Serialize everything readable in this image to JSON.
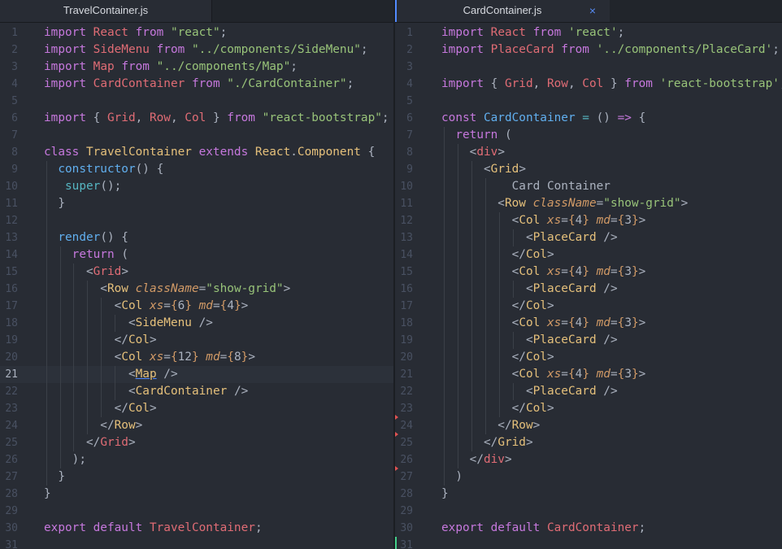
{
  "left_pane": {
    "tab": {
      "title": "TravelContainer.js"
    },
    "cursor_line": 21,
    "lines": [
      [
        [
          "k",
          "import "
        ],
        [
          "v",
          "React "
        ],
        [
          "k",
          "from "
        ],
        [
          "s",
          "\"react\""
        ],
        [
          "p",
          ";"
        ]
      ],
      [
        [
          "k",
          "import "
        ],
        [
          "v",
          "SideMenu "
        ],
        [
          "k",
          "from "
        ],
        [
          "s",
          "\"../components/SideMenu\""
        ],
        [
          "p",
          ";"
        ]
      ],
      [
        [
          "k",
          "import "
        ],
        [
          "v",
          "Map "
        ],
        [
          "k",
          "from "
        ],
        [
          "s",
          "\"../components/Map\""
        ],
        [
          "p",
          ";"
        ]
      ],
      [
        [
          "k",
          "import "
        ],
        [
          "v",
          "CardContainer "
        ],
        [
          "k",
          "from "
        ],
        [
          "s",
          "\"./CardContainer\""
        ],
        [
          "p",
          ";"
        ]
      ],
      [],
      [
        [
          "k",
          "import "
        ],
        [
          "p",
          "{ "
        ],
        [
          "v",
          "Grid"
        ],
        [
          "p",
          ", "
        ],
        [
          "v",
          "Row"
        ],
        [
          "p",
          ", "
        ],
        [
          "v",
          "Col "
        ],
        [
          "p",
          "} "
        ],
        [
          "k",
          "from "
        ],
        [
          "s",
          "\"react-bootstrap\""
        ],
        [
          "p",
          ";"
        ]
      ],
      [],
      [
        [
          "k",
          "class "
        ],
        [
          "c",
          "TravelContainer "
        ],
        [
          "k",
          "extends "
        ],
        [
          "c",
          "React"
        ],
        [
          "p",
          "."
        ],
        [
          "c",
          "Component "
        ],
        [
          "p",
          "{"
        ]
      ],
      [
        [
          "p",
          "  "
        ],
        [
          "f",
          "constructor"
        ],
        [
          "p",
          "() {"
        ]
      ],
      [
        [
          "p",
          "   "
        ],
        [
          "o",
          "super"
        ],
        [
          "p",
          "();"
        ]
      ],
      [
        [
          "p",
          "  }"
        ]
      ],
      [],
      [
        [
          "p",
          "  "
        ],
        [
          "f",
          "render"
        ],
        [
          "p",
          "() {"
        ]
      ],
      [
        [
          "p",
          "    "
        ],
        [
          "k",
          "return "
        ],
        [
          "p",
          "("
        ]
      ],
      [
        [
          "p",
          "      <"
        ],
        [
          "t",
          "Grid"
        ],
        [
          "p",
          ">"
        ]
      ],
      [
        [
          "p",
          "        <"
        ],
        [
          "c",
          "Row "
        ],
        [
          "a",
          "className"
        ],
        [
          "p",
          "="
        ],
        [
          "s",
          "\"show-grid\""
        ],
        [
          "p",
          ">"
        ]
      ],
      [
        [
          "p",
          "          <"
        ],
        [
          "c",
          "Col "
        ],
        [
          "a",
          "xs"
        ],
        [
          "p",
          "="
        ],
        [
          "n",
          "{"
        ],
        [
          "p",
          "6"
        ],
        [
          "n",
          "} "
        ],
        [
          "a",
          "md"
        ],
        [
          "p",
          "="
        ],
        [
          "n",
          "{"
        ],
        [
          "p",
          "4"
        ],
        [
          "n",
          "}"
        ],
        [
          "p",
          ">"
        ]
      ],
      [
        [
          "p",
          "            <"
        ],
        [
          "c",
          "SideMenu "
        ],
        [
          "p",
          "/>"
        ]
      ],
      [
        [
          "p",
          "          </"
        ],
        [
          "c",
          "Col"
        ],
        [
          "p",
          ">"
        ]
      ],
      [
        [
          "p",
          "          <"
        ],
        [
          "c",
          "Col "
        ],
        [
          "a",
          "xs"
        ],
        [
          "p",
          "="
        ],
        [
          "n",
          "{"
        ],
        [
          "p",
          "12"
        ],
        [
          "n",
          "} "
        ],
        [
          "a",
          "md"
        ],
        [
          "p",
          "="
        ],
        [
          "n",
          "{"
        ],
        [
          "p",
          "8"
        ],
        [
          "n",
          "}"
        ],
        [
          "p",
          ">"
        ]
      ],
      [
        [
          "p",
          "            <"
        ],
        [
          "c ul",
          "Map"
        ],
        [
          "p",
          " />"
        ]
      ],
      [
        [
          "p",
          "            <"
        ],
        [
          "c",
          "CardContainer "
        ],
        [
          "p",
          "/>"
        ]
      ],
      [
        [
          "p",
          "          </"
        ],
        [
          "c",
          "Col"
        ],
        [
          "p",
          ">"
        ]
      ],
      [
        [
          "p",
          "        </"
        ],
        [
          "c",
          "Row"
        ],
        [
          "p",
          ">"
        ]
      ],
      [
        [
          "p",
          "      </"
        ],
        [
          "t",
          "Grid"
        ],
        [
          "p",
          ">"
        ]
      ],
      [
        [
          "p",
          "    );"
        ]
      ],
      [
        [
          "p",
          "  }"
        ]
      ],
      [
        [
          "p",
          "}"
        ]
      ],
      [],
      [
        [
          "k",
          "export default "
        ],
        [
          "v",
          "TravelContainer"
        ],
        [
          "p",
          ";"
        ]
      ],
      []
    ]
  },
  "right_pane": {
    "tab": {
      "title": "CardContainer.js",
      "close_icon": "×"
    },
    "git_deleted_after_lines": [
      23,
      24,
      26
    ],
    "git_added_lines": [
      31
    ],
    "lines": [
      [
        [
          "k",
          "import "
        ],
        [
          "v",
          "React "
        ],
        [
          "k",
          "from "
        ],
        [
          "s",
          "'react'"
        ],
        [
          "p",
          ";"
        ]
      ],
      [
        [
          "k",
          "import "
        ],
        [
          "v",
          "PlaceCard "
        ],
        [
          "k",
          "from "
        ],
        [
          "s",
          "'../components/PlaceCard'"
        ],
        [
          "p",
          ";"
        ]
      ],
      [],
      [
        [
          "k",
          "import "
        ],
        [
          "p",
          "{ "
        ],
        [
          "v",
          "Grid"
        ],
        [
          "p",
          ", "
        ],
        [
          "v",
          "Row"
        ],
        [
          "p",
          ", "
        ],
        [
          "v",
          "Col "
        ],
        [
          "p",
          "} "
        ],
        [
          "k",
          "from "
        ],
        [
          "s",
          "'react-bootstrap'"
        ],
        [
          "p",
          ";"
        ]
      ],
      [],
      [
        [
          "k",
          "const "
        ],
        [
          "f",
          "CardContainer "
        ],
        [
          "o",
          "= "
        ],
        [
          "p",
          "() "
        ],
        [
          "k",
          "=> "
        ],
        [
          "p",
          "{"
        ]
      ],
      [
        [
          "p",
          "  "
        ],
        [
          "k",
          "return "
        ],
        [
          "p",
          "("
        ]
      ],
      [
        [
          "p",
          "    <"
        ],
        [
          "t",
          "div"
        ],
        [
          "p",
          ">"
        ]
      ],
      [
        [
          "p",
          "      <"
        ],
        [
          "c",
          "Grid"
        ],
        [
          "p",
          ">"
        ]
      ],
      [
        [
          "p",
          "          Card Container"
        ]
      ],
      [
        [
          "p",
          "        <"
        ],
        [
          "c",
          "Row "
        ],
        [
          "a",
          "className"
        ],
        [
          "p",
          "="
        ],
        [
          "s",
          "\"show-grid\""
        ],
        [
          "p",
          ">"
        ]
      ],
      [
        [
          "p",
          "          <"
        ],
        [
          "c",
          "Col "
        ],
        [
          "a",
          "xs"
        ],
        [
          "p",
          "="
        ],
        [
          "n",
          "{"
        ],
        [
          "p",
          "4"
        ],
        [
          "n",
          "} "
        ],
        [
          "a",
          "md"
        ],
        [
          "p",
          "="
        ],
        [
          "n",
          "{"
        ],
        [
          "p",
          "3"
        ],
        [
          "n",
          "}"
        ],
        [
          "p",
          ">"
        ]
      ],
      [
        [
          "p",
          "            <"
        ],
        [
          "c",
          "PlaceCard "
        ],
        [
          "p",
          "/>"
        ]
      ],
      [
        [
          "p",
          "          </"
        ],
        [
          "c",
          "Col"
        ],
        [
          "p",
          ">"
        ]
      ],
      [
        [
          "p",
          "          <"
        ],
        [
          "c",
          "Col "
        ],
        [
          "a",
          "xs"
        ],
        [
          "p",
          "="
        ],
        [
          "n",
          "{"
        ],
        [
          "p",
          "4"
        ],
        [
          "n",
          "} "
        ],
        [
          "a",
          "md"
        ],
        [
          "p",
          "="
        ],
        [
          "n",
          "{"
        ],
        [
          "p",
          "3"
        ],
        [
          "n",
          "}"
        ],
        [
          "p",
          ">"
        ]
      ],
      [
        [
          "p",
          "            <"
        ],
        [
          "c",
          "PlaceCard "
        ],
        [
          "p",
          "/>"
        ]
      ],
      [
        [
          "p",
          "          </"
        ],
        [
          "c",
          "Col"
        ],
        [
          "p",
          ">"
        ]
      ],
      [
        [
          "p",
          "          <"
        ],
        [
          "c",
          "Col "
        ],
        [
          "a",
          "xs"
        ],
        [
          "p",
          "="
        ],
        [
          "n",
          "{"
        ],
        [
          "p",
          "4"
        ],
        [
          "n",
          "} "
        ],
        [
          "a",
          "md"
        ],
        [
          "p",
          "="
        ],
        [
          "n",
          "{"
        ],
        [
          "p",
          "3"
        ],
        [
          "n",
          "}"
        ],
        [
          "p",
          ">"
        ]
      ],
      [
        [
          "p",
          "            <"
        ],
        [
          "c",
          "PlaceCard "
        ],
        [
          "p",
          "/>"
        ]
      ],
      [
        [
          "p",
          "          </"
        ],
        [
          "c",
          "Col"
        ],
        [
          "p",
          ">"
        ]
      ],
      [
        [
          "p",
          "          <"
        ],
        [
          "c",
          "Col "
        ],
        [
          "a",
          "xs"
        ],
        [
          "p",
          "="
        ],
        [
          "n",
          "{"
        ],
        [
          "p",
          "4"
        ],
        [
          "n",
          "} "
        ],
        [
          "a",
          "md"
        ],
        [
          "p",
          "="
        ],
        [
          "n",
          "{"
        ],
        [
          "p",
          "3"
        ],
        [
          "n",
          "}"
        ],
        [
          "p",
          ">"
        ]
      ],
      [
        [
          "p",
          "            <"
        ],
        [
          "c",
          "PlaceCard "
        ],
        [
          "p",
          "/>"
        ]
      ],
      [
        [
          "p",
          "          </"
        ],
        [
          "c",
          "Col"
        ],
        [
          "p",
          ">"
        ]
      ],
      [
        [
          "p",
          "        </"
        ],
        [
          "c",
          "Row"
        ],
        [
          "p",
          ">"
        ]
      ],
      [
        [
          "p",
          "      </"
        ],
        [
          "c",
          "Grid"
        ],
        [
          "p",
          ">"
        ]
      ],
      [
        [
          "p",
          "    </"
        ],
        [
          "t",
          "div"
        ],
        [
          "p",
          ">"
        ]
      ],
      [
        [
          "p",
          "  )"
        ]
      ],
      [
        [
          "p",
          "}"
        ]
      ],
      [],
      [
        [
          "k",
          "export default "
        ],
        [
          "v",
          "CardContainer"
        ],
        [
          "p",
          ";"
        ]
      ],
      []
    ]
  }
}
